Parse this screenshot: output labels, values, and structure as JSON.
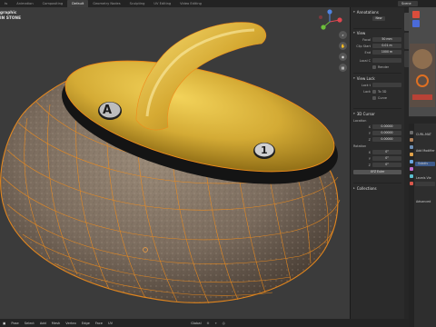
{
  "topbar": {
    "tabs": [
      "ts",
      "Animation",
      "Compositing",
      "Default",
      "Geometry Nodes",
      "Sculpting",
      "UV Editing",
      "Video Editing"
    ],
    "active_index": 3,
    "scene_label": "Scene"
  },
  "viewport": {
    "overlay_line1": "graphic",
    "overlay_line2": "IN STONE",
    "handle_letter": "A",
    "number_label": "1"
  },
  "npanel": {
    "annotations": {
      "title": "Annotations",
      "new_label": "New"
    },
    "view": {
      "title": "View",
      "rows": [
        {
          "label": "Focal",
          "value": "50 mm"
        },
        {
          "label": "Clip Start",
          "value": "0.01 m"
        },
        {
          "label": "End",
          "value": "1000 m"
        }
      ],
      "local_label": "Local C",
      "render_label": "Render"
    },
    "view_lock": {
      "title": "View Lock",
      "lock_to_label": "Lock t",
      "lock_label": "Lock",
      "to_3d_label": "To 3D",
      "curve_label": "Curve"
    },
    "cursor": {
      "title": "3D Cursor",
      "location_label": "Location",
      "loc": [
        "0.00000",
        "0.00000",
        "0.00000"
      ],
      "rotation_label": "Rotation",
      "rot": [
        "0°",
        "0°",
        "0°"
      ],
      "mode_label": "XYZ Euler"
    },
    "collections": {
      "title": "Collections"
    }
  },
  "right": {
    "props_title": "CURL-MAT",
    "add_modifier": "Add Modifier",
    "subdivision": "Subdiv",
    "levels_label": "Levels Vie",
    "advanced": "Advanced"
  },
  "statusbar": {
    "menus": [
      "Pose",
      "Select",
      "Add",
      "Mesh",
      "Vertex",
      "Edge",
      "Face",
      "UV"
    ],
    "orientation": "Global"
  },
  "colors": {
    "gold": "#c9a12e",
    "stone": "#7d6f62",
    "wire": "#f08c1b"
  }
}
